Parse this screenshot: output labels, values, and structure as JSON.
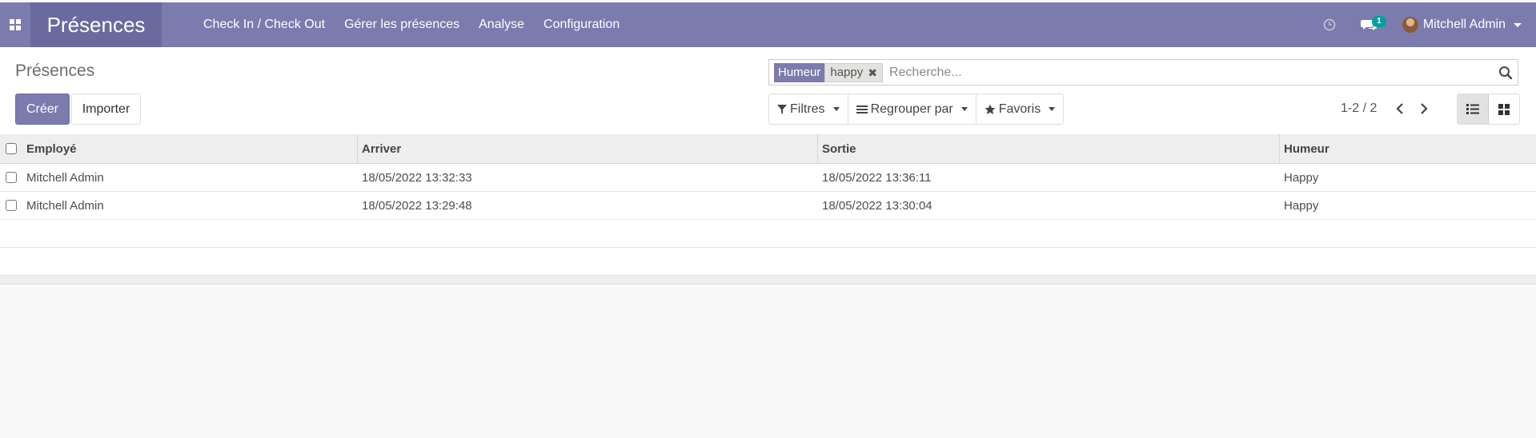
{
  "navbar": {
    "app_title": "Présences",
    "menu": [
      {
        "label": "Check In / Check Out"
      },
      {
        "label": "Gérer les présences"
      },
      {
        "label": "Analyse"
      },
      {
        "label": "Configuration"
      }
    ],
    "chat_badge": "1",
    "user_name": "Mitchell Admin",
    "color": "#7c7bad"
  },
  "control": {
    "breadcrumb": "Présences",
    "create_label": "Créer",
    "import_label": "Importer",
    "search": {
      "facet_category": "Humeur",
      "facet_value": "happy",
      "placeholder": "Recherche..."
    },
    "filters_label": "Filtres",
    "group_by_label": "Regrouper par",
    "favorites_label": "Favoris",
    "pager": "1-2 / 2"
  },
  "table": {
    "columns": [
      "Employé",
      "Arriver",
      "Sortie",
      "Humeur"
    ],
    "rows": [
      {
        "employee": "Mitchell Admin",
        "check_in": "18/05/2022 13:32:33",
        "check_out": "18/05/2022 13:36:11",
        "mood": "Happy"
      },
      {
        "employee": "Mitchell Admin",
        "check_in": "18/05/2022 13:29:48",
        "check_out": "18/05/2022 13:30:04",
        "mood": "Happy"
      }
    ]
  }
}
